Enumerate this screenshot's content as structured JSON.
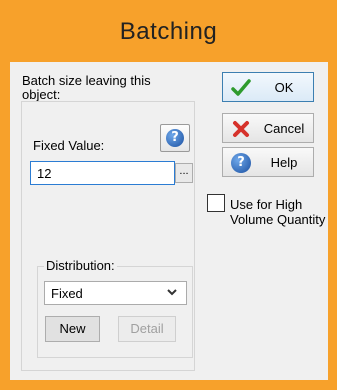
{
  "dialog": {
    "title": "Batching",
    "prompt": "Batch size leaving this object:"
  },
  "fixed_value": {
    "label": "Fixed Value:",
    "value": "12",
    "ellipsis_label": "..."
  },
  "distribution": {
    "label": "Distribution:",
    "selected": "Fixed",
    "new_label": "New",
    "detail_label": "Detail"
  },
  "buttons": {
    "ok": "OK",
    "cancel": "Cancel",
    "help": "Help"
  },
  "high_volume": {
    "label": "Use for High Volume Quantity",
    "checked": false
  },
  "icons": {
    "help_small": "question-icon",
    "ok": "check-icon",
    "cancel": "x-icon",
    "help": "question-icon",
    "dropdown": "chevron-down-icon"
  },
  "colors": {
    "frame": "#F7A12B",
    "client": "#F0F0F0",
    "input_focus_border": "#2B7CD3"
  }
}
